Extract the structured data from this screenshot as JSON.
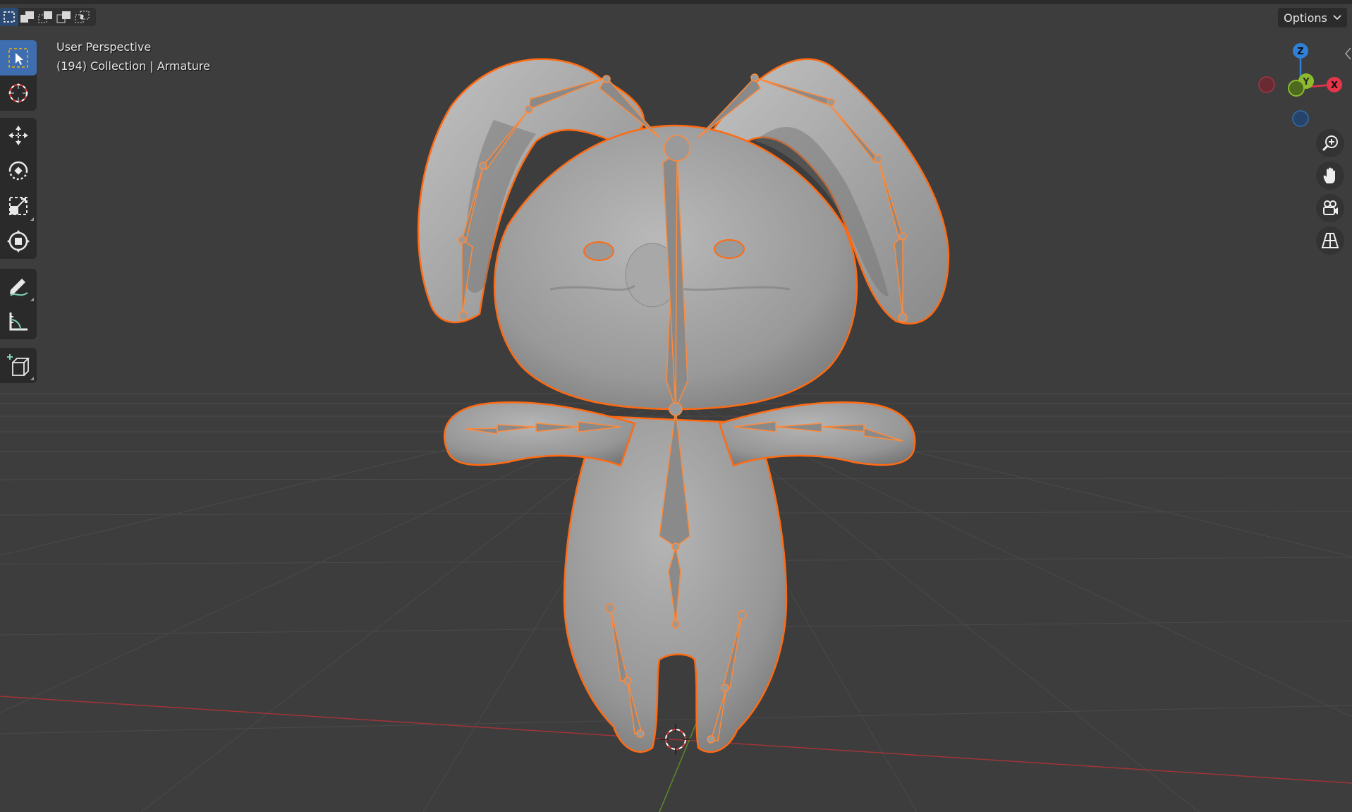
{
  "viewport": {
    "view_name": "User Perspective",
    "collection_line": "(194) Collection | Armature"
  },
  "header": {
    "options_label": "Options",
    "select_modes": [
      "select-new-icon",
      "select-extend-icon",
      "select-subtract-icon",
      "select-difference-icon",
      "select-intersect-icon"
    ]
  },
  "toolbar": {
    "tools": [
      {
        "name": "select-box",
        "icon": "cursor-box-icon",
        "active": true
      },
      {
        "name": "cursor",
        "icon": "3d-cursor-icon"
      },
      {
        "name": "move",
        "icon": "move-icon"
      },
      {
        "name": "rotate",
        "icon": "rotate-icon"
      },
      {
        "name": "scale",
        "icon": "scale-icon"
      },
      {
        "name": "transform",
        "icon": "transform-icon"
      },
      {
        "name": "annotate",
        "icon": "annotate-icon"
      },
      {
        "name": "measure",
        "icon": "measure-icon"
      },
      {
        "name": "add-cube",
        "icon": "add-cube-icon"
      }
    ]
  },
  "gizmo": {
    "z_label": "Z",
    "y_label": "Y",
    "x_label": "X",
    "colors": {
      "x": "#e6354b",
      "y": "#8cbb2d",
      "z": "#2f80d6",
      "outline": "#ff6a12"
    }
  },
  "navigation": {
    "buttons": [
      "zoom-icon",
      "pan-hand-icon",
      "camera-icon",
      "perspective-grid-icon"
    ]
  }
}
